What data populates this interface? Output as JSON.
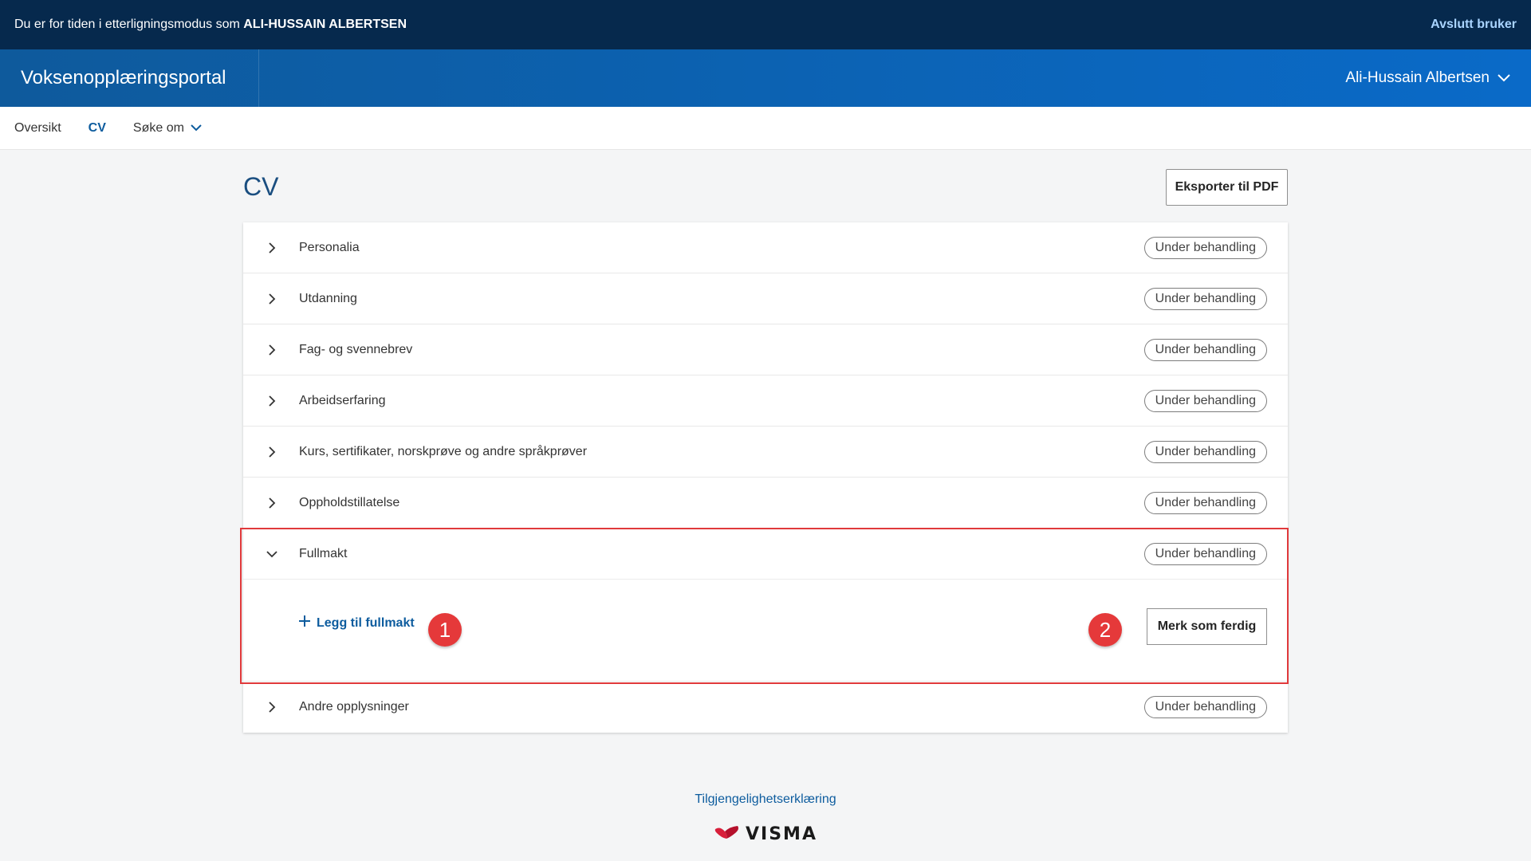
{
  "impersonation": {
    "prefix": "Du er for tiden i etterligningsmodus som ",
    "user_name": "ALI-HUSSAIN ALBERTSEN",
    "end_label": "Avslutt bruker"
  },
  "header": {
    "app_title": "Voksenopplæringsportal",
    "user_name": "Ali-Hussain Albertsen"
  },
  "subnav": {
    "items": [
      {
        "label": "Oversikt",
        "active": false
      },
      {
        "label": "CV",
        "active": true
      },
      {
        "label": "Søke om",
        "active": false,
        "dropdown": true
      }
    ]
  },
  "page": {
    "title": "CV",
    "export_label": "Eksporter til PDF"
  },
  "sections": [
    {
      "label": "Personalia",
      "status": "Under behandling",
      "expanded": false
    },
    {
      "label": "Utdanning",
      "status": "Under behandling",
      "expanded": false
    },
    {
      "label": "Fag- og svennebrev",
      "status": "Under behandling",
      "expanded": false
    },
    {
      "label": "Arbeidserfaring",
      "status": "Under behandling",
      "expanded": false
    },
    {
      "label": "Kurs, sertifikater, norskprøve og andre språkprøver",
      "status": "Under behandling",
      "expanded": false
    },
    {
      "label": "Oppholdstillatelse",
      "status": "Under behandling",
      "expanded": false
    },
    {
      "label": "Fullmakt",
      "status": "Under behandling",
      "expanded": true
    },
    {
      "label": "Andre opplysninger",
      "status": "Under behandling",
      "expanded": false
    }
  ],
  "fullmakt": {
    "add_label": "Legg til fullmakt",
    "mark_done_label": "Merk som ferdig"
  },
  "callouts": [
    "1",
    "2"
  ],
  "footer": {
    "accessibility_label": "Tilgjengelighetserklæring",
    "logo_text": "VISMA"
  },
  "colors": {
    "top_bar": "#06294d",
    "header": "#0a6ac8",
    "link": "#0d5c9e",
    "highlight": "#e0393b"
  }
}
